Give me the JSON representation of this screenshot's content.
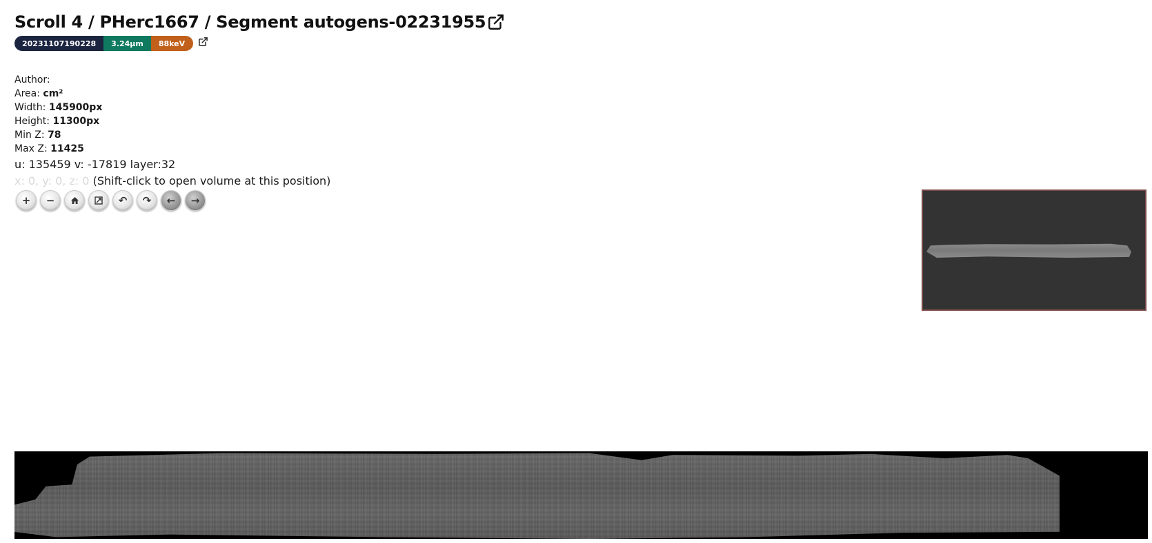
{
  "header": {
    "title": "Scroll 4 / PHerc1667 / Segment autogens-02231955",
    "title_link_icon": "external-link-icon",
    "badges": {
      "scan_id": "20231107190228",
      "resolution": "3.24µm",
      "energy": "88keV"
    },
    "badge_link_icon": "external-link-icon"
  },
  "meta": {
    "author_label": "Author:",
    "author_value": "",
    "area_label": "Area:",
    "area_value": "cm²",
    "width_label": "Width:",
    "width_value": "145900px",
    "height_label": "Height:",
    "height_value": "11300px",
    "minz_label": "Min Z:",
    "minz_value": "78",
    "maxz_label": "Max Z:",
    "maxz_value": "11425"
  },
  "coords": {
    "uv_text": "u: 135459 v: -17819 layer:32",
    "xyz_text": "x: 0, y: 0, z: 0",
    "hint_text": "(Shift-click to open volume at this position)"
  },
  "toolbar": {
    "buttons": [
      {
        "name": "zoom-in",
        "glyph": "+"
      },
      {
        "name": "zoom-out",
        "glyph": "−"
      },
      {
        "name": "home",
        "glyph": "⌂"
      },
      {
        "name": "fullscreen",
        "glyph": "⤢"
      },
      {
        "name": "rotate-left",
        "glyph": "↶"
      },
      {
        "name": "rotate-right",
        "glyph": "↷"
      },
      {
        "name": "previous",
        "glyph": "←"
      },
      {
        "name": "next",
        "glyph": "→"
      }
    ]
  },
  "colors": {
    "badge_date": "#1b2540",
    "badge_resolution": "#0f7a5f",
    "badge_energy": "#c0601a",
    "navigator_bg": "#333333",
    "navigator_border": "#7a4a46"
  }
}
